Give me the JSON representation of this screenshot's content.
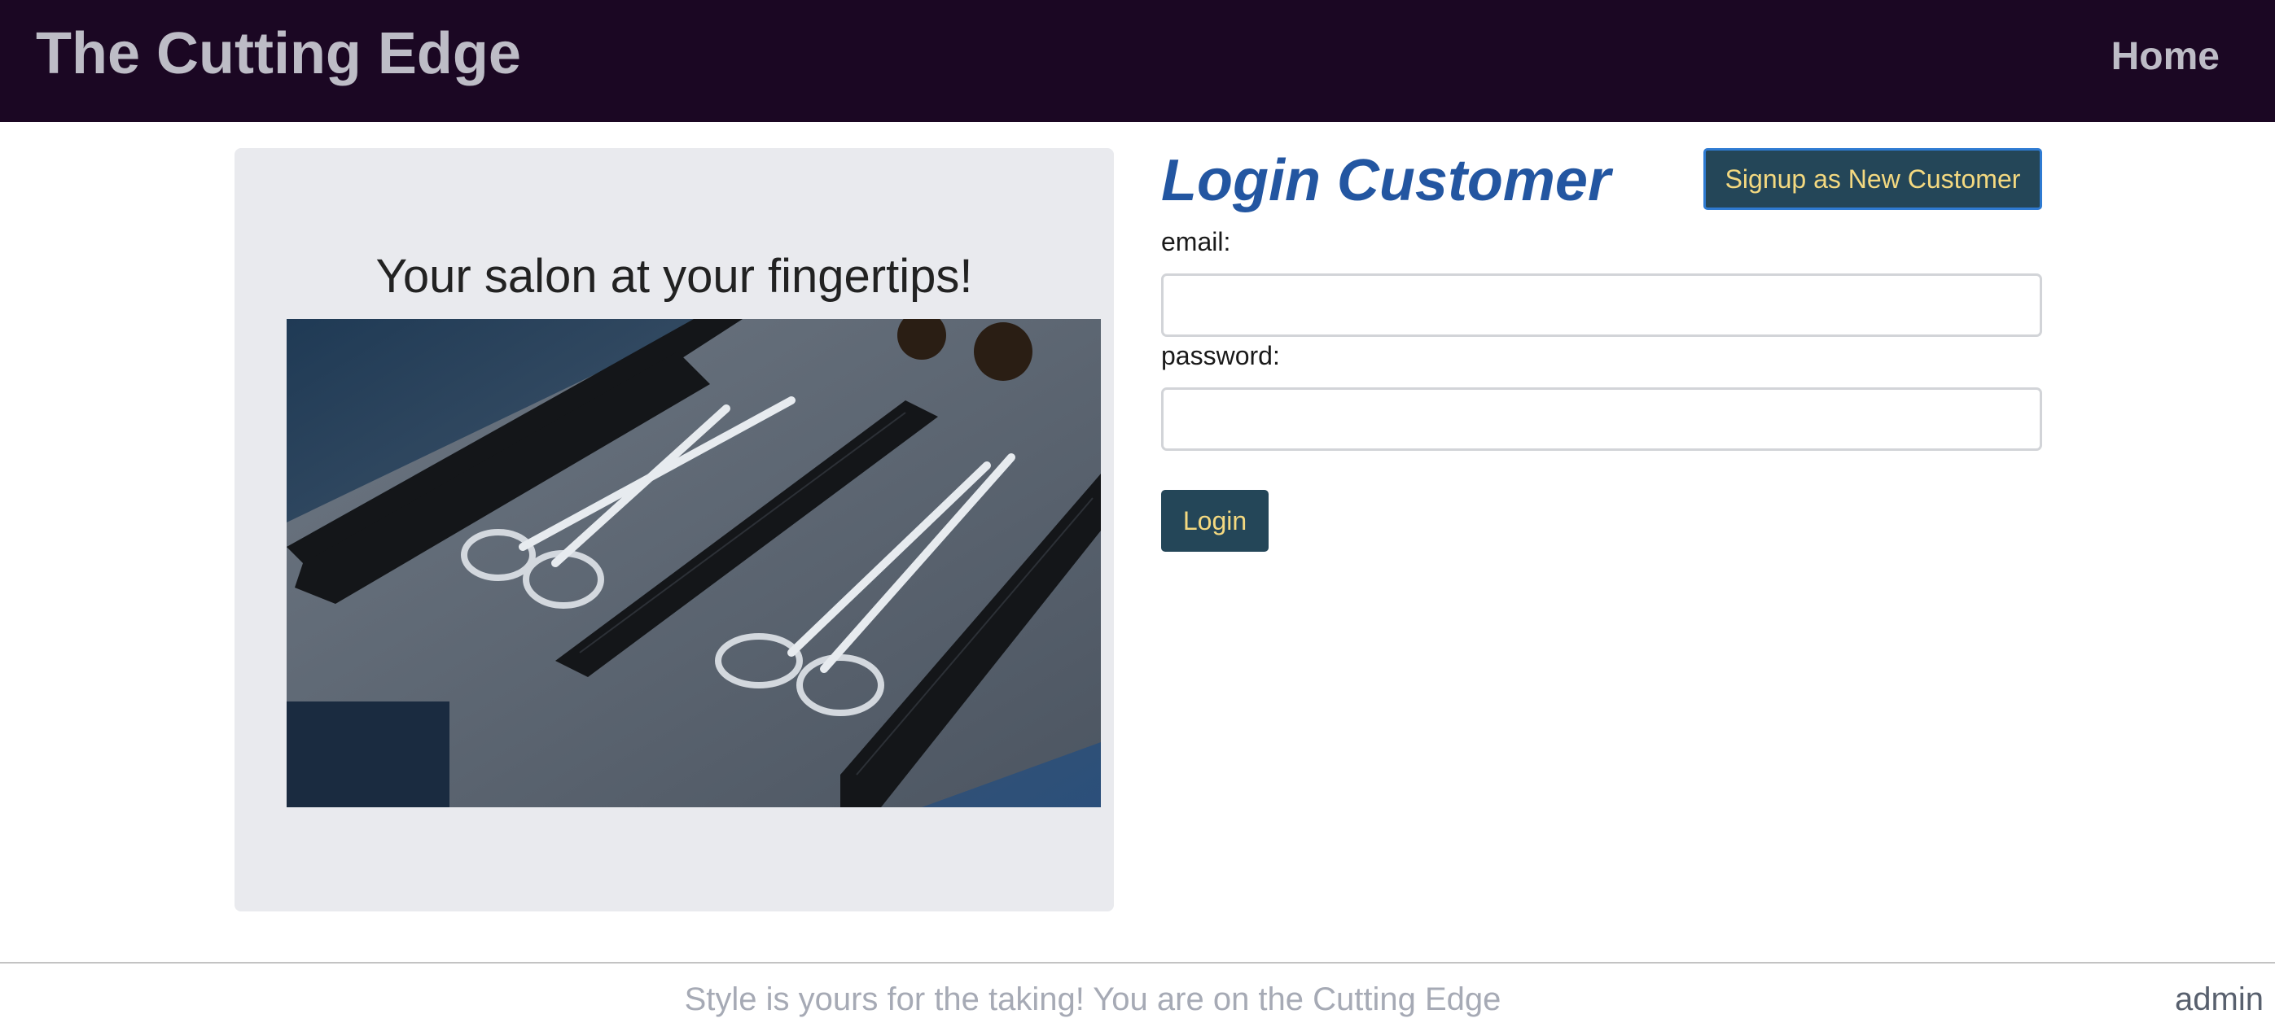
{
  "navbar": {
    "brand": "The Cutting Edge",
    "home_label": "Home",
    "background": "#1b0723"
  },
  "hero": {
    "tagline": "Your salon at your fingertips!"
  },
  "login": {
    "title": "Login Customer",
    "signup_label": "Signup as New Customer",
    "email_label": "email:",
    "email_value": "",
    "password_label": "password:",
    "password_value": "",
    "submit_label": "Login",
    "accent": "#2356a1",
    "button_bg": "#244658",
    "button_text": "#f4d980"
  },
  "footer": {
    "text": "Style is yours for the taking! You are on the Cutting Edge",
    "admin_label": "admin"
  }
}
